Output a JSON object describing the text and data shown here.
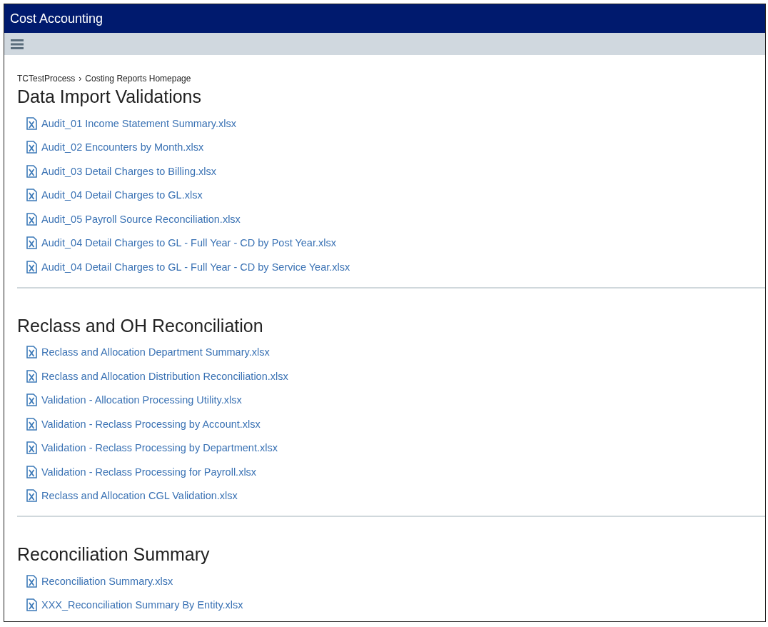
{
  "window": {
    "title": "Cost Accounting"
  },
  "breadcrumb": [
    {
      "label": "TCTestProcess",
      "separator": "›"
    },
    {
      "label": "Costing Reports Homepage"
    }
  ],
  "sections": [
    {
      "title": "Data Import Validations",
      "files": [
        {
          "name": "Audit_01 Income Statement Summary.xlsx"
        },
        {
          "name": "Audit_02 Encounters by Month.xlsx"
        },
        {
          "name": "Audit_03 Detail Charges to Billing.xlsx"
        },
        {
          "name": "Audit_04 Detail Charges to GL.xlsx"
        },
        {
          "name": "Audit_05 Payroll Source Reconciliation.xlsx"
        },
        {
          "name": "Audit_04 Detail Charges to GL - Full Year - CD by Post Year.xlsx"
        },
        {
          "name": "Audit_04 Detail Charges to GL - Full Year - CD by Service Year.xlsx"
        }
      ]
    },
    {
      "title": "Reclass and OH Reconciliation",
      "files": [
        {
          "name": "Reclass and Allocation Department Summary.xlsx"
        },
        {
          "name": "Reclass and Allocation Distribution Reconciliation.xlsx"
        },
        {
          "name": "Validation - Allocation Processing Utility.xlsx"
        },
        {
          "name": "Validation - Reclass Processing by Account.xlsx"
        },
        {
          "name": "Validation - Reclass Processing by Department.xlsx"
        },
        {
          "name": "Validation - Reclass Processing for Payroll.xlsx"
        },
        {
          "name": "Reclass and Allocation CGL Validation.xlsx"
        }
      ]
    },
    {
      "title": "Reconciliation Summary",
      "files": [
        {
          "name": "Reconciliation Summary.xlsx"
        },
        {
          "name": "XXX_Reconciliation Summary By Entity.xlsx"
        }
      ]
    }
  ]
}
